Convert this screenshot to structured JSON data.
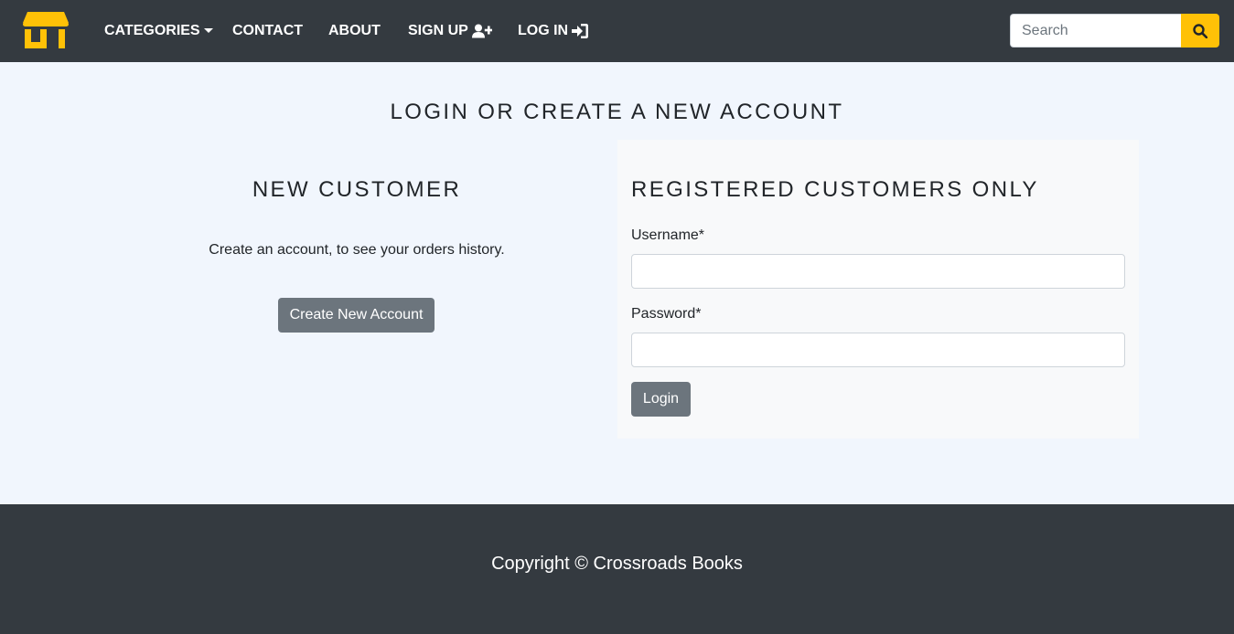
{
  "header": {
    "logo_icon": "store-icon",
    "nav": {
      "categories": "CATEGORIES",
      "contact": "CONTACT",
      "about": "ABOUT",
      "signup": "SIGN UP",
      "login": "LOG IN"
    },
    "search": {
      "placeholder": "Search",
      "value": ""
    }
  },
  "main": {
    "title": "LOGIN OR CREATE A NEW ACCOUNT",
    "new_customer": {
      "title": "NEW CUSTOMER",
      "text": "Create an account, to see your orders history.",
      "button": "Create New Account"
    },
    "registered": {
      "title": "REGISTERED CUSTOMERS ONLY",
      "username_label": "Username*",
      "username_value": "",
      "password_label": "Password*",
      "password_value": "",
      "button": "Login"
    }
  },
  "footer": {
    "copyright": "Copyright © Crossroads Books"
  },
  "colors": {
    "navbar": "#343a40",
    "accent": "#ffc107",
    "page_bg": "#f1f6fd",
    "card_bg": "#f8f9fa",
    "button": "#6c757d"
  }
}
